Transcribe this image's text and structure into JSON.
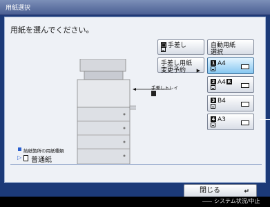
{
  "window": {
    "title": "用紙選択"
  },
  "instruction": "用紙を選んでください。",
  "tray_label": "手差しトレイ",
  "buttons": {
    "manual_feed": {
      "label": "手差し"
    },
    "auto_select": {
      "label": "自動用紙\n選択"
    },
    "manual_reserve": {
      "label": "手差し用紙\n変更予約"
    }
  },
  "drawers": [
    {
      "num": "1",
      "size": "A4",
      "selected": true
    },
    {
      "num": "2",
      "size": "A4",
      "badge": "R",
      "selected": false
    },
    {
      "num": "3",
      "size": "B4",
      "selected": false
    },
    {
      "num": "4",
      "size": "A3",
      "selected": false
    }
  ],
  "legend": {
    "text": "給紙箇所の用紙種類"
  },
  "paper_type": {
    "label": "普通紙"
  },
  "close_button": {
    "label": "閉じる",
    "icon": "enter-icon"
  },
  "status_bar": {
    "label": "システム状況/中止"
  },
  "colors": {
    "accent": "#2a5fd0",
    "selected": "#86c7f0",
    "titlebar": "#4a5f93"
  }
}
